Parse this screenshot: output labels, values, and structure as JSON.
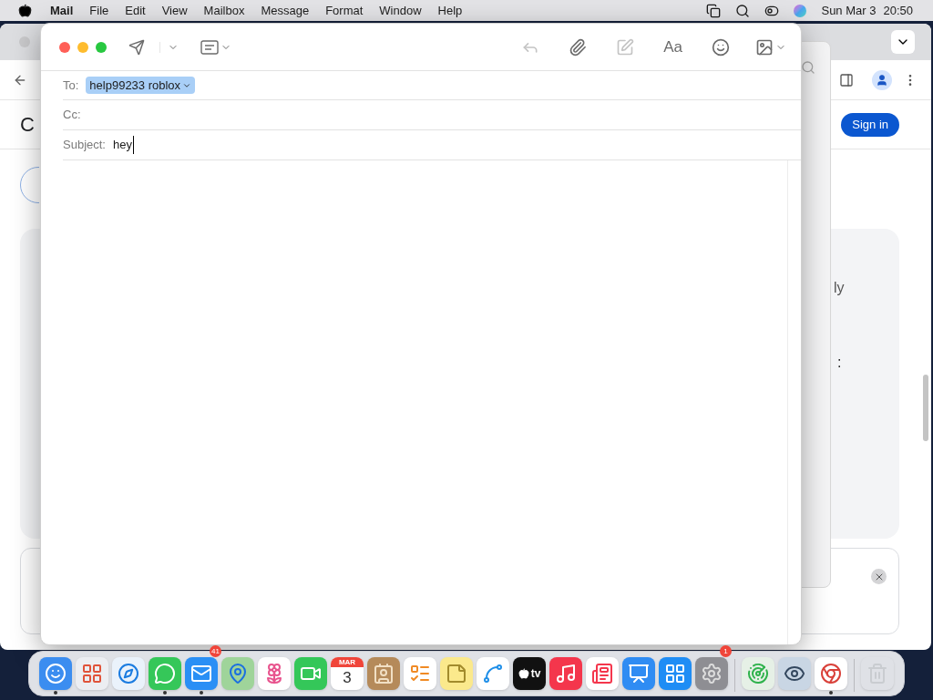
{
  "menubar": {
    "app": "Mail",
    "menus": [
      "File",
      "Edit",
      "View",
      "Mailbox",
      "Message",
      "Format",
      "Window",
      "Help"
    ],
    "date": "Sun Mar 3",
    "time": "20:50"
  },
  "browser": {
    "heading": "C",
    "sign_in": "Sign in",
    "card_text_1": "ly",
    "card_text_2": ":"
  },
  "compose": {
    "toolbar": [
      {
        "kind": "send",
        "disabled": false
      },
      {
        "kind": "chevron",
        "disabled": false
      },
      {
        "kind": "header",
        "disabled": false
      },
      {
        "kind": "reply",
        "disabled": true
      },
      {
        "kind": "attach",
        "disabled": false
      },
      {
        "kind": "markup",
        "disabled": true
      },
      {
        "kind": "format",
        "label": "Aa",
        "disabled": false
      },
      {
        "kind": "emoji",
        "disabled": false
      },
      {
        "kind": "photo",
        "disabled": false
      }
    ],
    "to_label": "To:",
    "recipient": {
      "name": "help99233 roblox",
      "selected": true
    },
    "cc_label": "Cc:",
    "subject_label": "Subject:",
    "subject": "hey"
  },
  "dock": {
    "items": [
      {
        "kind": "finder",
        "running": true
      },
      {
        "kind": "launchpad",
        "running": false
      },
      {
        "kind": "safari",
        "running": false
      },
      {
        "kind": "messages",
        "running": true
      },
      {
        "kind": "mail",
        "running": true,
        "badge": "41"
      },
      {
        "kind": "maps",
        "running": false
      },
      {
        "kind": "photos",
        "running": false
      },
      {
        "kind": "facetime",
        "running": false
      },
      {
        "kind": "calendar",
        "running": false,
        "month": "MAR",
        "day": "3"
      },
      {
        "kind": "contacts",
        "running": false
      },
      {
        "kind": "reminders",
        "running": false
      },
      {
        "kind": "notes",
        "running": false
      },
      {
        "kind": "freeform",
        "running": false
      },
      {
        "kind": "tv",
        "running": false,
        "label": "tv"
      },
      {
        "kind": "music",
        "running": false
      },
      {
        "kind": "news",
        "running": false
      },
      {
        "kind": "keynote",
        "running": false
      },
      {
        "kind": "appstore",
        "running": false
      },
      {
        "kind": "settings",
        "running": false,
        "badge": "1"
      },
      {
        "kind": "separator"
      },
      {
        "kind": "findmy",
        "running": false
      },
      {
        "kind": "preview",
        "running": false
      },
      {
        "kind": "chrome",
        "running": true
      },
      {
        "kind": "separator"
      },
      {
        "kind": "trash",
        "running": false
      }
    ]
  }
}
